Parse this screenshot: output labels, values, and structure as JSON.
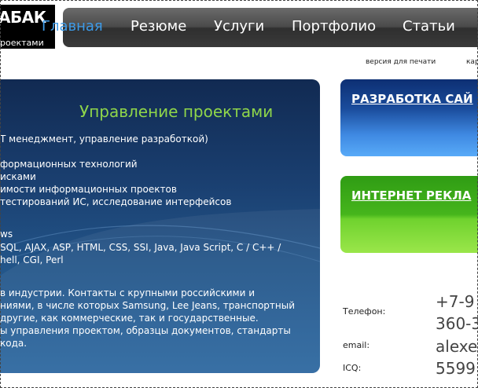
{
  "header": {
    "logo_text": "АБАК",
    "logo_sub": "роектами",
    "nav": [
      {
        "label": "Главная",
        "active": true
      },
      {
        "label": "Резюме",
        "active": false
      },
      {
        "label": "Услуги",
        "active": false
      },
      {
        "label": "Портфолио",
        "active": false
      },
      {
        "label": "Статьи",
        "active": false
      }
    ]
  },
  "links": {
    "print": "версия для печати",
    "map": "кар"
  },
  "main": {
    "title": "Управление проектами",
    "lines": [
      "Т менеджмент, управление разработкой)",
      "",
      "формационных технологий",
      "исками",
      "имости информационных проектов",
      "тестирований ИС, исследование интерфейсов",
      "ws",
      "SQL, AJAX, ASP, HTML, CSS, SSI, Java, Java Script, C / C++ /",
      "hell, CGI, Perl",
      "в индустрии. Контакты с крупными российскими и",
      "ниями, в числе которых Samsung, Lee Jeans, транспортный",
      "другие, как коммерческие, так и государственные.",
      "ы управления проектом, образцы документов, стандарты",
      "кода."
    ]
  },
  "banners": {
    "development": "РАЗРАБОТКА САЙ",
    "advertising": "ИНТЕРНЕТ РЕКЛА"
  },
  "contacts": {
    "phone_label": "Телефон:",
    "phone_line1": "+7-9",
    "phone_line2": "360-3",
    "email_label": "email:",
    "email_value": "alexe",
    "icq_label": "ICQ:",
    "icq_value": "5599"
  },
  "colors": {
    "nav_active": "#3d9be9",
    "panel_title": "#8fd64a",
    "panel_bg": "#1a3f70",
    "banner_blue": "#1a4c9c",
    "banner_green": "#46b51c"
  }
}
